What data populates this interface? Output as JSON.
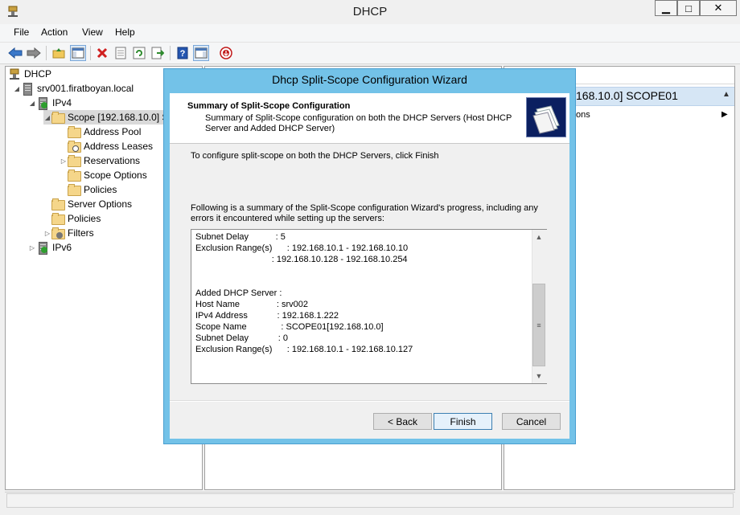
{
  "app": {
    "title": "DHCP"
  },
  "window_buttons": {
    "minimize": "▁",
    "maximize": "□",
    "close": "✕"
  },
  "menu": [
    "File",
    "Action",
    "View",
    "Help"
  ],
  "tree": {
    "root": "DHCP",
    "server": "srv001.firatboyan.local",
    "ipv4": "IPv4",
    "scope": "Scope [192.168.10.0] S",
    "scope_children": [
      "Address Pool",
      "Address Leases",
      "Reservations",
      "Scope Options",
      "Policies"
    ],
    "ipv4_children": [
      "Server Options",
      "Policies",
      "Filters"
    ],
    "ipv6": "IPv6"
  },
  "actions": {
    "scope_header": "168.10.0] SCOPE01",
    "more_actions": "ons"
  },
  "dialog": {
    "title": "Dhcp Split-Scope Configuration Wizard",
    "summary_title": "Summary of Split-Scope Configuration",
    "summary_desc": "Summary of Split-Scope configuration on both the DHCP Servers (Host DHCP Server and Added DHCP Server)",
    "instruction": "To configure split-scope on both the DHCP Servers, click Finish",
    "following": "Following is a summary of the Split-Scope configuration Wizard's progress, including any errors it encountered while setting up the servers:",
    "summary_lines": [
      "Subnet Delay           : 5",
      "Exclusion Range(s)      : 192.168.10.1 - 192.168.10.10",
      "                               : 192.168.10.128 - 192.168.10.254",
      "",
      "",
      "Added DHCP Server :",
      "Host Name               : srv002",
      "IPv4 Address            : 192.168.1.222",
      "Scope Name              : SCOPE01[192.168.10.0]",
      "Subnet Delay            : 0",
      "Exclusion Range(s)      : 192.168.10.1 - 192.168.10.127"
    ],
    "buttons": {
      "back": "< Back",
      "finish": "Finish",
      "cancel": "Cancel"
    }
  },
  "colors": {
    "dialog_border": "#73c2e8",
    "scope_selected": "#d6e6f5",
    "wizard_icon_bg": "#0b1f60"
  }
}
